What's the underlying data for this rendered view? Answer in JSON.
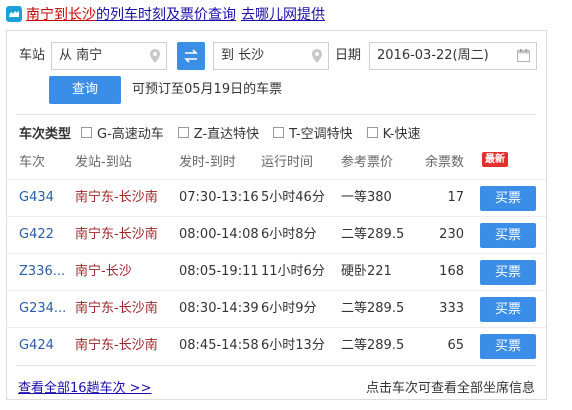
{
  "title": {
    "part_red": "南宁到长沙",
    "part_mid": "的列车时刻及票价查询",
    "part_blue": "去哪儿网提供"
  },
  "search": {
    "station_label": "车站",
    "from_value": "从 南宁",
    "to_value": "到 长沙",
    "date_label": "日期",
    "date_value": "2016-03-22(周二)",
    "query_button": "查询",
    "presale_note": "可预订至05月19日的车票"
  },
  "train_types": {
    "label": "车次类型",
    "options": [
      "G-高速动车",
      "Z-直达特快",
      "T-空调特快",
      "K-快速"
    ]
  },
  "table": {
    "headers": [
      "车次",
      "发站-到站",
      "发时-到时",
      "运行时间",
      "参考票价",
      "余票数"
    ],
    "new_badge": "最新",
    "rows": [
      {
        "code": "G434",
        "from": "南宁东",
        "to": "长沙南",
        "time": "07:30-13:16",
        "duration": "5小时46分",
        "price": "一等380",
        "count": "17",
        "buy": "买票"
      },
      {
        "code": "G422",
        "from": "南宁东",
        "to": "长沙南",
        "time": "08:00-14:08",
        "duration": "6小时8分",
        "price": "二等289.5",
        "count": "230",
        "buy": "买票"
      },
      {
        "code": "Z336...",
        "from": "南宁",
        "to": "长沙",
        "time": "08:05-19:11",
        "duration": "11小时6分",
        "price": "硬卧221",
        "count": "168",
        "buy": "买票"
      },
      {
        "code": "G234...",
        "from": "南宁东",
        "to": "长沙南",
        "time": "08:30-14:39",
        "duration": "6小时9分",
        "price": "二等289.5",
        "count": "333",
        "buy": "买票"
      },
      {
        "code": "G424",
        "from": "南宁东",
        "to": "长沙南",
        "time": "08:45-14:58",
        "duration": "6小时13分",
        "price": "二等289.5",
        "count": "65",
        "buy": "买票"
      }
    ]
  },
  "footer": {
    "view_all": "查看全部16趟车次 >>",
    "hint": "点击车次可查看全部坐席信息"
  },
  "colors": {
    "accent": "#3b8ee8",
    "station_red": "#a0262a",
    "link_blue": "#1a0dab",
    "code_blue": "#2b5ca8",
    "badge_red": "#e0302c"
  },
  "icons": [
    "camel-logo-icon",
    "location-pin-icon",
    "swap-arrows-icon",
    "calendar-icon"
  ]
}
